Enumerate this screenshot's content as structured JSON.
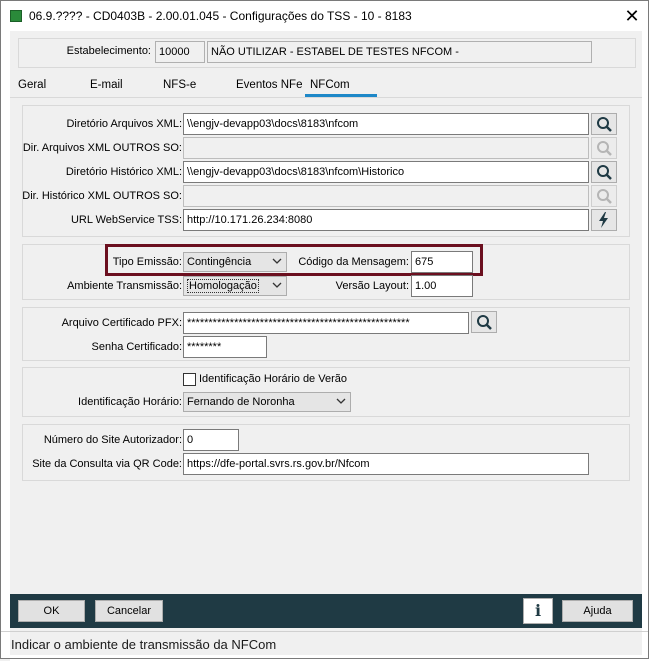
{
  "window": {
    "title": "06.9.???? - CD0403B - 2.00.01.045 - Configurações do TSS - 10 - 8183",
    "close_glyph": "✕"
  },
  "establishment": {
    "label": "Estabelecimento:",
    "code": "10000",
    "name": "NÃO UTILIZAR - ESTABEL DE TESTES NFCOM -"
  },
  "tabs": [
    {
      "label": "Geral",
      "active": false
    },
    {
      "label": "E-mail",
      "active": false
    },
    {
      "label": "NFS-e",
      "active": false
    },
    {
      "label": "Eventos NFe",
      "active": false
    },
    {
      "label": "NFCom",
      "active": true
    }
  ],
  "paths": {
    "dir_xml": {
      "label": "Diretório Arquivos XML:",
      "value": "\\\\engjv-devapp03\\docs\\8183\\nfcom"
    },
    "dir_xml_other": {
      "label": "Dir. Arquivos XML OUTROS SO:",
      "value": ""
    },
    "dir_hist": {
      "label": "Diretório Histórico XML:",
      "value": "\\\\engjv-devapp03\\docs\\8183\\nfcom\\Historico"
    },
    "dir_hist_other": {
      "label": "Dir. Histórico XML OUTROS SO:",
      "value": ""
    },
    "url_ws": {
      "label": "URL WebService TSS:",
      "value": "http://10.171.26.234:8080"
    }
  },
  "emission": {
    "tipo_label": "Tipo Emissão:",
    "tipo_value": "Contingência",
    "codigo_label": "Código da Mensagem:",
    "codigo_value": "675",
    "ambiente_label": "Ambiente Transmissão:",
    "ambiente_value": "Homologação",
    "versao_label": "Versão Layout:",
    "versao_value": "1.00"
  },
  "certificate": {
    "arquivo_label": "Arquivo Certificado PFX:",
    "arquivo_value": "****************************************************",
    "senha_label": "Senha Certificado:",
    "senha_value": "********"
  },
  "time": {
    "horario_verao_label": "Identificação Horário de Verão",
    "ident_label": "Identificação Horário:",
    "ident_value": "Fernando de Noronha"
  },
  "site": {
    "numero_label": "Número do Site Autorizador:",
    "numero_value": "0",
    "qr_label": "Site da Consulta via QR Code:",
    "qr_value": "https://dfe-portal.svrs.rs.gov.br/Nfcom"
  },
  "footer": {
    "ok": "OK",
    "cancel": "Cancelar",
    "help": "Ajuda",
    "info_glyph": "i"
  },
  "status_text": "Indicar o ambiente de transmissão da NFCom",
  "colors": {
    "highlight_box": "#6b0f1f",
    "tab_underline": "#1e88c8",
    "footer_bar": "#1f3a44"
  }
}
